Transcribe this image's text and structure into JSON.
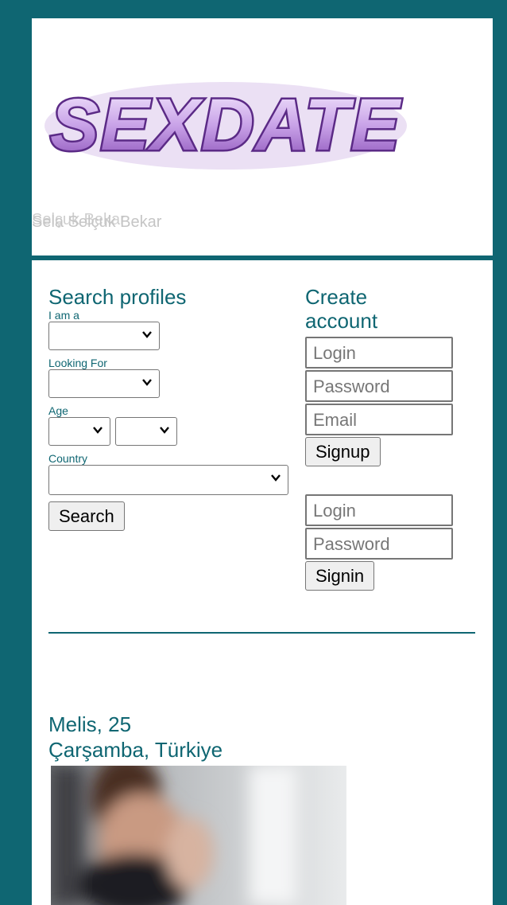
{
  "header": {
    "logo_text": "SEXDATE",
    "subtitle_ghost": "Selçuk Bekar",
    "subtitle": "Sela Selçuk Bekar"
  },
  "search": {
    "title": "Search profiles",
    "i_am_label": "I am a",
    "looking_for_label": "Looking For",
    "age_label": "Age",
    "country_label": "Country",
    "search_button": "Search"
  },
  "signup": {
    "title_line1": "Create",
    "title_line2": "account",
    "login_placeholder": "Login",
    "password_placeholder": "Password",
    "email_placeholder": "Email",
    "signup_button": "Signup"
  },
  "signin": {
    "login_placeholder": "Login",
    "password_placeholder": "Password",
    "signin_button": "Signin"
  },
  "profile": {
    "name_age": "Melis, 25",
    "location": "Çarşamba, Türkiye"
  },
  "colors": {
    "accent": "#0f6672",
    "logo_purple": "#8a4fb8"
  }
}
